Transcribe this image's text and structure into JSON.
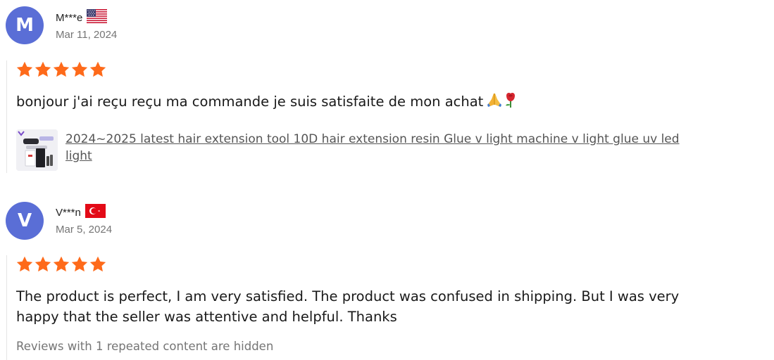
{
  "reviews": [
    {
      "avatar_letter": "M",
      "avatar_color": "#5a6ed6",
      "user": "M***e",
      "flag": "us-flag-icon",
      "date": "Mar 11, 2024",
      "rating": 5,
      "text": "bonjour j'ai reçu reçu ma commande je suis satisfaite de mon achat",
      "emoji": [
        "folded-hands-icon",
        "rose-icon"
      ],
      "product": {
        "title": "2024~2025 latest hair extension tool 10D hair extension resin Glue v light machine v light glue uv led light"
      }
    },
    {
      "avatar_letter": "V",
      "avatar_color": "#5a6ed6",
      "user": "V***n",
      "flag": "turkey-flag-icon",
      "date": "Mar 5, 2024",
      "rating": 5,
      "text": "The product is perfect, I am very satisfied. The product was confused in shipping. But I was very happy that the seller was attentive and helpful. Thanks"
    }
  ],
  "footer": {
    "hidden_note": "Reviews with 1 repeated content are hidden"
  },
  "colors": {
    "star": "#fe6a1a",
    "avatar": "#5a6ed6",
    "link": "#555555"
  }
}
